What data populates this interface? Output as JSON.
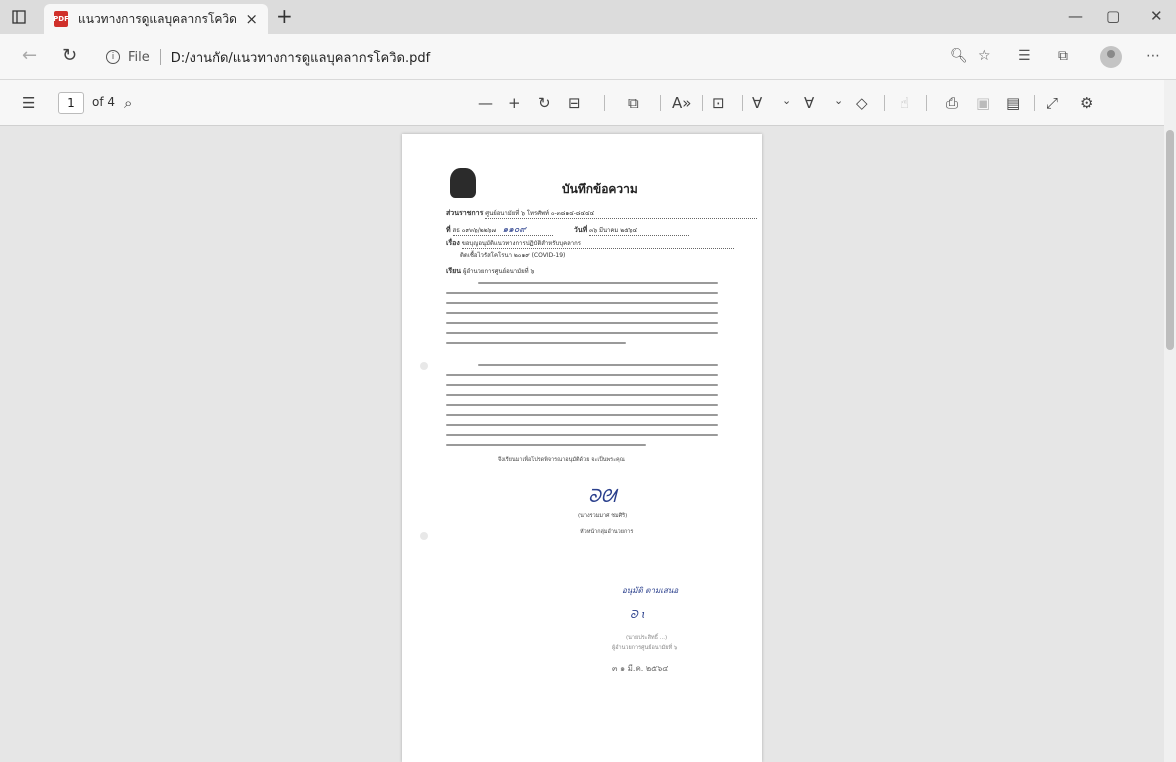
{
  "browser": {
    "tab": {
      "title": "แนวทางการดูแลบุคลากรโควิด.pdf",
      "close": "×",
      "new_tab": "+"
    },
    "window": {
      "minimize": "—",
      "restore": "▢",
      "close": "✕"
    },
    "address": {
      "scheme": "File",
      "path": "D:/งานกัด/แนวทางการดูแลบุคลากรโควิด.pdf"
    }
  },
  "pdf_toolbar": {
    "page_current": "1",
    "page_total": "of 4",
    "icons": [
      "contents-icon",
      "search-icon",
      "zoom-out-icon",
      "zoom-in-icon",
      "rotate-icon",
      "fit-page-icon",
      "page-view-icon",
      "read-aloud-icon",
      "immersive-reader-icon",
      "draw-icon",
      "highlight-icon",
      "erase-icon",
      "touch-icon",
      "print-icon",
      "save-icon",
      "save-as-icon",
      "fullscreen-icon",
      "settings-icon"
    ]
  },
  "document": {
    "title": "บันทึกข้อความ",
    "agency_label": "ส่วนราชการ",
    "agency_value": "ศูนย์อนามัยที่ ๖   โทรศัพท์ ๐-๓๘๑๔-๘๔๔๔",
    "ref_label": "ที่",
    "ref_value": "สธ ๐๙๓๖/๒๒๖๗",
    "ref_hand": "๑๑๐๙",
    "date_label": "วันที่",
    "date_value": "๓๖   มีนาคม   ๒๕๖๔",
    "date_hand": "๓๖",
    "subject_label": "เรื่อง",
    "subject_value": "ขอบุญอนุมัติแนวทางการปฏิบัติสำหรับบุคลากร",
    "subject_value_2": "ติดเชื้อไวรัสโคโรนา ๒๐๑๙ (COVID-19)",
    "to_label": "เรียน",
    "to_value": "ผู้อำนวยการศูนย์อนามัยที่ ๖",
    "closing": "จึงเรียนมาเพื่อโปรดพิจารณาอนุมัติด้วย จะเป็นพระคุณ",
    "signer_name": "(นางรวมมาศ ชมศิริ)",
    "signer_position": "หัวหน้ากลุ่มอำนวยการ",
    "approve_note": "อนุมัติ  ตามเสนอ",
    "approver_name": "(นายประสิทธิ์ ...)",
    "approver_position": "ผู้อำนวยการศูนย์อนามัยที่ ๖",
    "stamp_date": "๓ ๑ มี.ค. ๒๕๖๔"
  }
}
